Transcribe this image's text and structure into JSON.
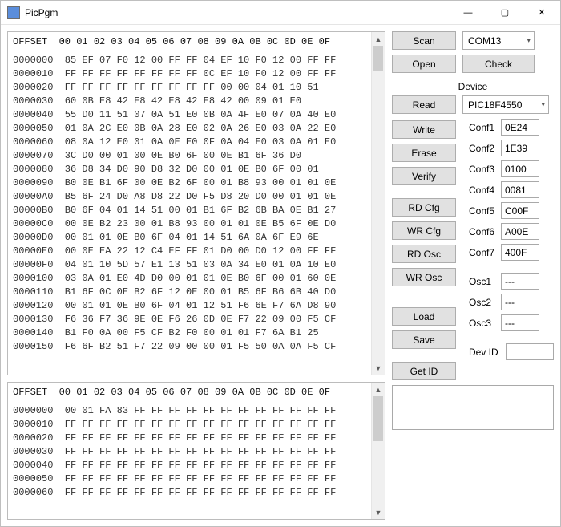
{
  "title": "PicPgm",
  "window_buttons": {
    "minimize": "—",
    "maximize": "▢",
    "close": "✕"
  },
  "hex": {
    "header": "OFFSET  00 01 02 03 04 05 06 07 08 09 0A 0B 0C 0D 0E 0F",
    "top_rows": [
      "0000000  85 EF 07 F0 12 00 FF FF 04 EF 10 F0 12 00 FF FF",
      "0000010  FF FF FF FF FF FF FF FF 0C EF 10 F0 12 00 FF FF",
      "0000020  FF FF FF FF FF FF FF FF FF 00 00 04 01 10 51",
      "0000030  60 0B E8 42 E8 42 E8 42 E8 42 00 09 01 E0",
      "0000040  55 D0 11 51 07 0A 51 E0 0B 0A 4F E0 07 0A 40 E0",
      "0000050  01 0A 2C E0 0B 0A 28 E0 02 0A 26 E0 03 0A 22 E0",
      "0000060  08 0A 12 E0 01 0A 0E E0 0F 0A 04 E0 03 0A 01 E0",
      "0000070  3C D0 00 01 00 0E B0 6F 00 0E B1 6F 36 D0",
      "0000080  36 D8 34 D0 90 D8 32 D0 00 01 0E B0 6F 00 01",
      "0000090  B0 0E B1 6F 00 0E B2 6F 00 01 B8 93 00 01 01 0E",
      "00000A0  B5 6F 24 D0 A8 D8 22 D0 F5 D8 20 D0 00 01 01 0E",
      "00000B0  B0 6F 04 01 14 51 00 01 B1 6F B2 6B BA 0E B1 27",
      "00000C0  00 0E B2 23 00 01 B8 93 00 01 01 0E B5 6F 0E D0",
      "00000D0  00 01 01 0E B0 6F 04 01 14 51 6A 0A 6F E9 6E",
      "00000E0  00 0E EA 22 12 C4 EF FF 01 D0 00 D0 12 00 FF FF",
      "00000F0  04 01 10 5D 57 E1 13 51 03 0A 34 E0 01 0A 10 E0",
      "0000100  03 0A 01 E0 4D D0 00 01 01 0E B0 6F 00 01 60 0E",
      "0000110  B1 6F 0C 0E B2 6F 12 0E 00 01 B5 6F B6 6B 40 D0",
      "0000120  00 01 01 0E B0 6F 04 01 12 51 F6 6E F7 6A D8 90",
      "0000130  F6 36 F7 36 9E 0E F6 26 0D 0E F7 22 09 00 F5 CF",
      "0000140  B1 F0 0A 00 F5 CF B2 F0 00 01 01 F7 6A B1 25",
      "0000150  F6 6F B2 51 F7 22 09 00 00 01 F5 50 0A 0A F5 CF"
    ],
    "bottom_rows": [
      "0000000  00 01 FA 83 FF FF FF FF FF FF FF FF FF FF FF FF",
      "0000010  FF FF FF FF FF FF FF FF FF FF FF FF FF FF FF FF",
      "0000020  FF FF FF FF FF FF FF FF FF FF FF FF FF FF FF FF",
      "0000030  FF FF FF FF FF FF FF FF FF FF FF FF FF FF FF FF",
      "0000040  FF FF FF FF FF FF FF FF FF FF FF FF FF FF FF FF",
      "0000050  FF FF FF FF FF FF FF FF FF FF FF FF FF FF FF FF",
      "0000060  FF FF FF FF FF FF FF FF FF FF FF FF FF FF FF FF"
    ]
  },
  "controls": {
    "scan": "Scan",
    "open": "Open",
    "check": "Check",
    "com_port": "COM13",
    "device_label": "Device",
    "read": "Read",
    "write": "Write",
    "erase": "Erase",
    "verify": "Verify",
    "rd_cfg": "RD Cfg",
    "wr_cfg": "WR Cfg",
    "rd_osc": "RD Osc",
    "wr_osc": "WR Osc",
    "load": "Load",
    "save": "Save",
    "get_id": "Get ID",
    "device_selected": "PIC18F4550"
  },
  "config": {
    "labels": {
      "conf1": "Conf1",
      "conf2": "Conf2",
      "conf3": "Conf3",
      "conf4": "Conf4",
      "conf5": "Conf5",
      "conf6": "Conf6",
      "conf7": "Conf7",
      "osc1": "Osc1",
      "osc2": "Osc2",
      "osc3": "Osc3",
      "devid": "Dev ID"
    },
    "values": {
      "conf1": "0E24",
      "conf2": "1E39",
      "conf3": "0100",
      "conf4": "0081",
      "conf5": "C00F",
      "conf6": "A00E",
      "conf7": "400F",
      "osc1": "---",
      "osc2": "---",
      "osc3": "---",
      "devid": ""
    }
  }
}
